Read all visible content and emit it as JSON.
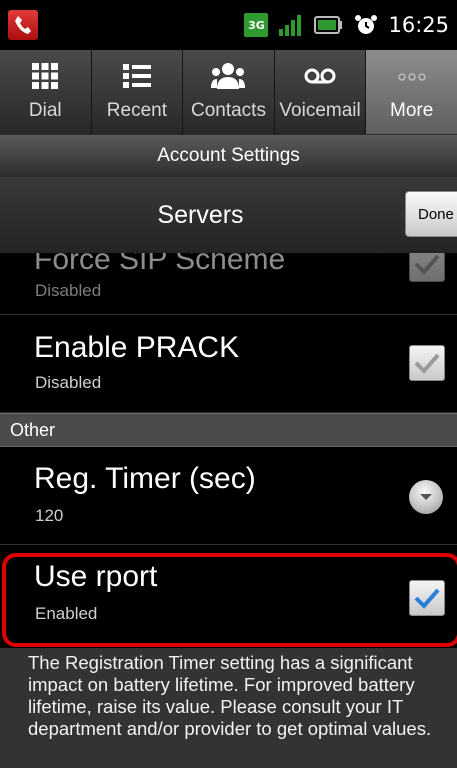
{
  "status_bar": {
    "network_label": "3G",
    "time": "16:25"
  },
  "tabs": [
    {
      "label": "Dial",
      "icon": "dialpad-icon",
      "active": false
    },
    {
      "label": "Recent",
      "icon": "list-icon",
      "active": false
    },
    {
      "label": "Contacts",
      "icon": "contacts-icon",
      "active": false
    },
    {
      "label": "Voicemail",
      "icon": "voicemail-icon",
      "active": false
    },
    {
      "label": "More",
      "icon": "more-icon",
      "active": true
    }
  ],
  "account_bar": {
    "title": "Account Settings"
  },
  "servers_bar": {
    "title": "Servers",
    "done_label": "Done"
  },
  "settings": {
    "force_sip": {
      "title": "Force SIP Scheme",
      "value": "Disabled",
      "checked": true
    },
    "enable_prack": {
      "title": "Enable PRACK",
      "value": "Disabled",
      "checked": true
    },
    "section_other": "Other",
    "reg_timer": {
      "title": "Reg. Timer (sec)",
      "value": "120"
    },
    "use_rport": {
      "title": "Use rport",
      "value": "Enabled",
      "checked": true
    }
  },
  "footer": {
    "text": "The Registration Timer setting has a significant impact on battery lifetime. For improved battery lifetime, raise its value. Please consult your IT department and/or provider to get optimal values."
  },
  "colors": {
    "highlight": "#e00000",
    "check_blue": "#2a7fd6",
    "check_gray": "#9a9a9a",
    "network_green": "#2f9a2f"
  }
}
